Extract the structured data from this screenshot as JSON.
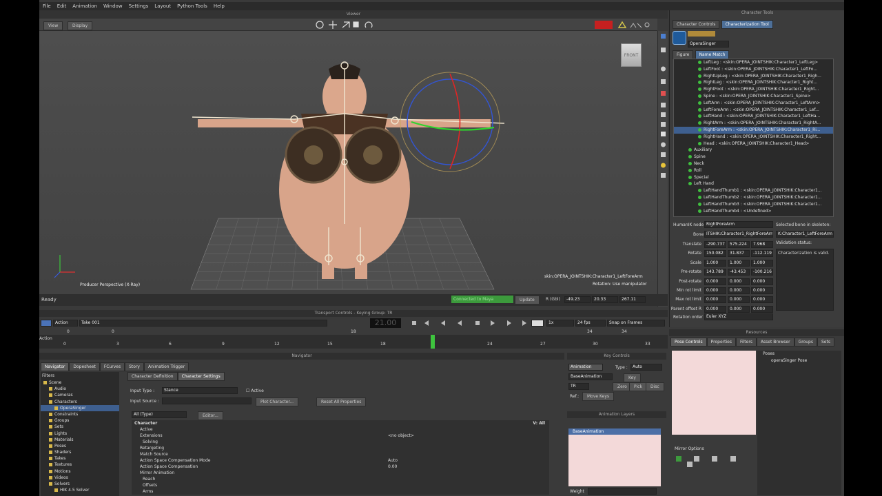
{
  "menu": [
    "File",
    "Edit",
    "Animation",
    "Window",
    "Settings",
    "Layout",
    "Python Tools",
    "Help"
  ],
  "viewer": {
    "title": "Viewer",
    "view_btn": "View",
    "display_btn": "Display",
    "cube_label": "FRONT",
    "camera_label": "Producer Perspective (X-Ray)",
    "selection_info": "skin:OPERA_JOINTSHIK:Character1_LeftForeArm",
    "rotation_info": "Rotation: Use manipulator"
  },
  "status": {
    "text": "Ready",
    "connected": "Connected to Maya",
    "update": "Update",
    "r_label": "R (Gbl)",
    "x": "-49.23",
    "y": "20.33",
    "z": "267.11"
  },
  "char_tools": {
    "title": "Character Tools",
    "tabs": [
      "Character Controls",
      "Characterization Tool"
    ],
    "character_name": "OperaSinger",
    "subtabs": [
      "Figure",
      "Name Match"
    ],
    "tree_rows": [
      {
        "text": "LeftLeg : <skin:OPERA_JOINTSHIK:Character1_LeftLeg>",
        "indent": 5,
        "dot": true
      },
      {
        "text": "LeftFoot : <skin:OPERA_JOINTSHIK:Character1_LeftFo...",
        "indent": 5,
        "dot": true
      },
      {
        "text": "RightUpLeg : <skin:OPERA_JOINTSHIK:Character1_Righ...",
        "indent": 5,
        "dot": true
      },
      {
        "text": "RightLeg : <skin:OPERA_JOINTSHIK:Character1_Right...",
        "indent": 5,
        "dot": true
      },
      {
        "text": "RightFoot : <skin:OPERA_JOINTSHIK:Character1_Right...",
        "indent": 5,
        "dot": true
      },
      {
        "text": "Spine : <skin:OPERA_JOINTSHIK:Character1_Spine>",
        "indent": 5,
        "dot": true
      },
      {
        "text": "LeftArm : <skin:OPERA_JOINTSHIK:Character1_LeftArm>",
        "indent": 5,
        "dot": true
      },
      {
        "text": "LeftForeArm : <skin:OPERA_JOINTSHIK:Character1_Lef...",
        "indent": 5,
        "dot": true
      },
      {
        "text": "LeftHand : <skin:OPERA_JOINTSHIK:Character1_LeftHa...",
        "indent": 5,
        "dot": true
      },
      {
        "text": "RightArm : <skin:OPERA_JOINTSHIK:Character1_RightA...",
        "indent": 5,
        "dot": true
      },
      {
        "text": "RightForeArm : <skin:OPERA_JOINTSHIK:Character1_Ri...",
        "indent": 5,
        "dot": true,
        "selected": true
      },
      {
        "text": "RightHand : <skin:OPERA_JOINTSHIK:Character1_Right...",
        "indent": 5,
        "dot": true
      },
      {
        "text": "Head : <skin:OPERA_JOINTSHIK:Character1_Head>",
        "indent": 5,
        "dot": true
      },
      {
        "text": "Auxiliary",
        "indent": 3,
        "dot": true
      },
      {
        "text": "Spine",
        "indent": 3,
        "dot": true
      },
      {
        "text": "Neck",
        "indent": 3,
        "dot": true
      },
      {
        "text": "Roll",
        "indent": 3,
        "dot": true
      },
      {
        "text": "Special",
        "indent": 3,
        "dot": true
      },
      {
        "text": "Left Hand",
        "indent": 3,
        "dot": true
      },
      {
        "text": "LeftHandThumb1 : <skin:OPERA_JOINTSHIK:Character1...",
        "indent": 5,
        "dot": true
      },
      {
        "text": "LeftHandThumb2 : <skin:OPERA_JOINTSHIK:Character1...",
        "indent": 5,
        "dot": true
      },
      {
        "text": "LeftHandThumb3 : <skin:OPERA_JOINTSHIK:Character1...",
        "indent": 5,
        "dot": true
      },
      {
        "text": "LeftHandThumb4 : <Undefined>",
        "indent": 5,
        "dot": true
      }
    ],
    "humanik_label": "HumanIK node",
    "humanik_value": "RightForeArm",
    "selected_bone_label": "Selected bone in skeleton:",
    "bone_label": "Bone",
    "bone_value": "ITSHIK:Character1_RightForeArm",
    "bone_selected": "K:Character1_LeftForeArm",
    "validation_label": "Validation status:",
    "validation_msg": "Characterization is valid.",
    "props": [
      {
        "label": "Translate",
        "v": [
          "-290.737",
          "575.224",
          "7.968"
        ]
      },
      {
        "label": "Rotate",
        "v": [
          "150.082",
          "31.837",
          "-112.119"
        ]
      },
      {
        "label": "Scale",
        "v": [
          "1.000",
          "1.000",
          "1.000"
        ]
      },
      {
        "label": "Pre-rotate",
        "v": [
          "143.789",
          "-43.453",
          "-100.216"
        ]
      },
      {
        "label": "Post-rotate",
        "v": [
          "0.000",
          "0.000",
          "0.000"
        ]
      },
      {
        "label": "Min rot limit",
        "v": [
          "0.000",
          "0.000",
          "0.000"
        ]
      },
      {
        "label": "Max rot limit",
        "v": [
          "0.000",
          "0.000",
          "0.000"
        ]
      },
      {
        "label": "Parent offset R",
        "v": [
          "0.000",
          "0.000",
          "0.000"
        ]
      }
    ],
    "rot_order_label": "Rotation order",
    "rot_order_value": "Euler XYZ"
  },
  "transport": {
    "title": "Transport Controls - Keying Group: TR",
    "mode": "Action",
    "take": "Take 001",
    "frame": "21.00",
    "speed": "1x",
    "fps": "24 fps",
    "snap": "Snap on Frames",
    "range_start": "0",
    "range_start2": "0",
    "range_mid": "18",
    "range_end": "34",
    "range_end2": "34",
    "ruler_label": "Action",
    "ticks": [
      "0",
      "3",
      "6",
      "9",
      "12",
      "15",
      "18",
      "24",
      "27",
      "30",
      "33"
    ]
  },
  "navigator": {
    "title": "Navigator",
    "tabs": [
      "Navigator",
      "Dopesheet",
      "FCurves",
      "Story",
      "Animation Trigger"
    ],
    "filters": "Filters",
    "items": [
      {
        "text": "Scene",
        "indent": 0
      },
      {
        "text": "Audio",
        "indent": 1
      },
      {
        "text": "Cameras",
        "indent": 1
      },
      {
        "text": "Characters",
        "indent": 1
      },
      {
        "text": "OperaSinger",
        "indent": 2,
        "selected": true
      },
      {
        "text": "Constraints",
        "indent": 1
      },
      {
        "text": "Groups",
        "indent": 1
      },
      {
        "text": "Sets",
        "indent": 1
      },
      {
        "text": "Lights",
        "indent": 1
      },
      {
        "text": "Materials",
        "indent": 1
      },
      {
        "text": "Poses",
        "indent": 1
      },
      {
        "text": "Shaders",
        "indent": 1
      },
      {
        "text": "Takes",
        "indent": 1
      },
      {
        "text": "Textures",
        "indent": 1
      },
      {
        "text": "Motions",
        "indent": 1
      },
      {
        "text": "Videos",
        "indent": 1
      },
      {
        "text": "Solvers",
        "indent": 1
      },
      {
        "text": "HIK 4.5 Solver",
        "indent": 2
      }
    ],
    "char_tabs": [
      "Character Definition",
      "Character Settings"
    ],
    "input_type_label": "Input Type :",
    "input_type_value": "Stance",
    "active_label": "Active",
    "input_source_label": "Input Source :",
    "plot_btn": "Plot Character...",
    "reset_btn": "Reset All Properties",
    "all_type": "All (Type)",
    "editor_btn": "Editor...",
    "prop_rows": [
      {
        "text": "Character",
        "indent": 0,
        "bold": true,
        "right": "V: All"
      },
      {
        "text": "Active",
        "indent": 2
      },
      {
        "text": "Extensions",
        "indent": 2,
        "value": "<no object>"
      },
      {
        "text": "Solving",
        "indent": 3
      },
      {
        "text": "Retargeting",
        "indent": 2
      },
      {
        "text": "Match Source",
        "indent": 2
      },
      {
        "text": "Action Space Compensation Mode",
        "indent": 2,
        "value": "Auto"
      },
      {
        "text": "Action Space Compensation",
        "indent": 2,
        "value": "0.00"
      },
      {
        "text": "Mirror Animation",
        "indent": 2
      },
      {
        "text": "Reach",
        "indent": 3
      },
      {
        "text": "Offsets",
        "indent": 3
      },
      {
        "text": "Arms",
        "indent": 3
      }
    ]
  },
  "keys": {
    "title": "Key Controls",
    "animation_tab": "Animation",
    "base_tab": "BaseAnimation",
    "type_label": "Type :",
    "type_value": "Auto",
    "key_btn": "Key",
    "tr_value": "TR",
    "zero_btn": "Zero",
    "pick_btn": "Pick",
    "disc_btn": "Disc",
    "ref_label": "Ref.:",
    "move_keys": "Move Keys",
    "layers_title": "Animation Layers",
    "layer_name": "BaseAnimation",
    "weight_label": "Weight"
  },
  "resources": {
    "title": "Resources",
    "tabs": [
      "Pose Controls",
      "Properties",
      "Filters",
      "Asset Browser",
      "Groups",
      "Sets"
    ],
    "mirror": "Mirror Options",
    "poses_folder": "Poses",
    "pose_item": "operaSinger Pose"
  }
}
